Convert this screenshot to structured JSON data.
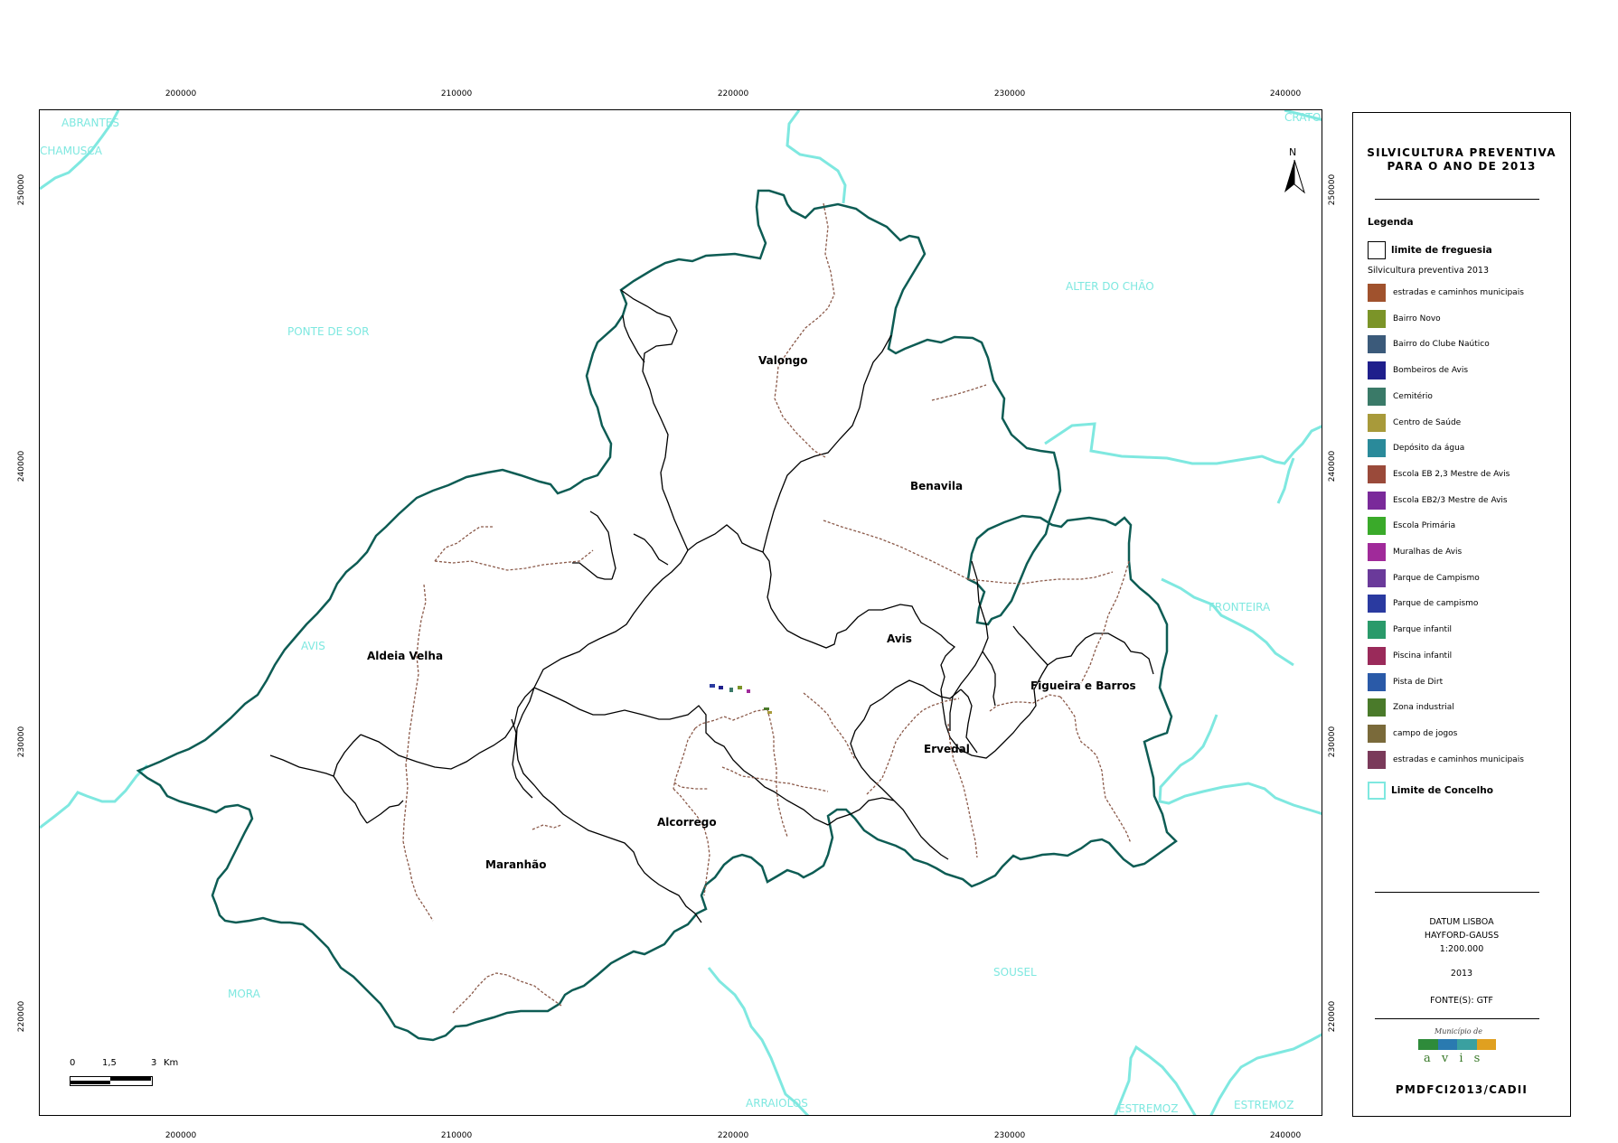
{
  "axes": {
    "x_ticks": [
      "200000",
      "210000",
      "220000",
      "230000",
      "240000"
    ],
    "y_ticks": [
      "250000",
      "240000",
      "230000",
      "220000"
    ]
  },
  "map": {
    "parishes": [
      "Valongo",
      "Benavila",
      "Aldeia Velha",
      "Avis",
      "Figueira e Barros",
      "Ervedal",
      "Alcorrego",
      "Maranhão"
    ],
    "neighbours": [
      "ABRANTES",
      "CHAMUSCA",
      "PONTE DE SOR",
      "ALTER DO CHÃO",
      "FRONTEIRA",
      "AVIS",
      "MORA",
      "SOUSEL",
      "ARRAIOLOS",
      "ESTREMOZ",
      "ESTREMOZ",
      "CRATO"
    ],
    "north_label": "N",
    "scale": {
      "ticks": [
        "0",
        "1,5",
        "3"
      ],
      "unit": "Km"
    },
    "boundary_color": "#0d5c54",
    "county_color": "#7fe8e0"
  },
  "legend": {
    "title_line1": "SILVICULTURA PREVENTIVA",
    "title_line2": "PARA O ANO DE 2013",
    "heading": "Legenda",
    "parish_limit_label": "limite de freguesia",
    "subheading": "Silvicultura preventiva 2013",
    "items": [
      {
        "label": "estradas e caminhos municipais",
        "color": "#a0522d"
      },
      {
        "label": "Bairro Novo",
        "color": "#7b9428"
      },
      {
        "label": "Bairro do Clube Naútico",
        "color": "#3b5a7a"
      },
      {
        "label": "Bombeiros de Avis",
        "color": "#1f1f8c"
      },
      {
        "label": "Cemitério",
        "color": "#3a7a68"
      },
      {
        "label": "Centro de Saúde",
        "color": "#a89a3a"
      },
      {
        "label": "Depósito da água",
        "color": "#2a8a9a"
      },
      {
        "label": "Escola EB 2,3 Mestre de Avis",
        "color": "#9a4a3a"
      },
      {
        "label": "Escola EB2/3 Mestre de Avis",
        "color": "#7a2a9a"
      },
      {
        "label": "Escola Primária",
        "color": "#3aaa2a"
      },
      {
        "label": "Muralhas de Avis",
        "color": "#a02a9a"
      },
      {
        "label": "Parque de Campismo",
        "color": "#6a3a9a"
      },
      {
        "label": "Parque de campismo",
        "color": "#2a3aa0"
      },
      {
        "label": "Parque infantil",
        "color": "#2a9a6a"
      },
      {
        "label": "Piscina infantil",
        "color": "#9a2a5a"
      },
      {
        "label": "Pista de Dirt",
        "color": "#2a5aa8"
      },
      {
        "label": "Zona industrial",
        "color": "#4a7a2a"
      },
      {
        "label": "campo de jogos",
        "color": "#7a6a3a"
      },
      {
        "label": "estradas e caminhos municipais",
        "color": "#7a3a5a"
      }
    ],
    "county_limit_label": "Limite de Concelho",
    "datum1": "DATUM LISBOA",
    "datum2": "HAYFORD-GAUSS",
    "scale_text": "1:200.000",
    "year": "2013",
    "source": "FONTE(S): GTF",
    "logo_caption": "Município de",
    "logo_word": "a v i s",
    "code": "PMDFCI2013/CADII"
  }
}
